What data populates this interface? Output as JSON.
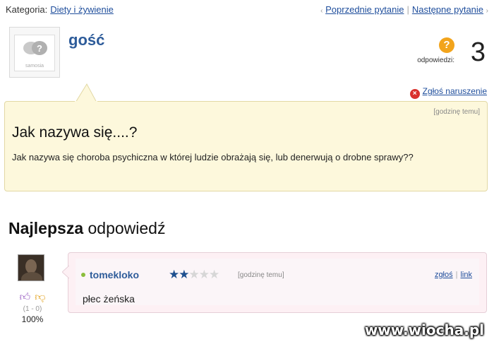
{
  "topbar": {
    "category_label": "Kategoria:",
    "category_link": "Diety i żywienie",
    "prev_label": "Poprzednie pytanie",
    "next_label": "Następne pytanie"
  },
  "asker": {
    "name": "gość",
    "avatar_brand": "samosia"
  },
  "answers_count": {
    "label": "odpowiedzi:",
    "value": "3"
  },
  "report_label": "Zgłoś naruszenie",
  "question": {
    "time": "[godzinę temu]",
    "title": "Jak nazywa się....?",
    "body": "Jak nazywa się choroba psychiczna w której ludzie obrażają się, lub denerwują o drobne sprawy??"
  },
  "best_answer": {
    "heading_bold": "Najlepsza",
    "heading_rest": " odpowiedź",
    "username": "tomekloko",
    "rating": 2,
    "rating_max": 5,
    "time": "[godzinę temu]",
    "report": "zgłoś",
    "link": "link",
    "text": "płec żeńska",
    "votes_ratio": "(1 - 0)",
    "votes_pct": "100%"
  },
  "watermark": "www.wiocha.pl",
  "colors": {
    "link": "#1f4e9c",
    "question_bg": "#fdf8dc",
    "answer_bg": "#fdf0f4",
    "badge_orange": "#f2a41c",
    "report_red": "#d9302c"
  }
}
